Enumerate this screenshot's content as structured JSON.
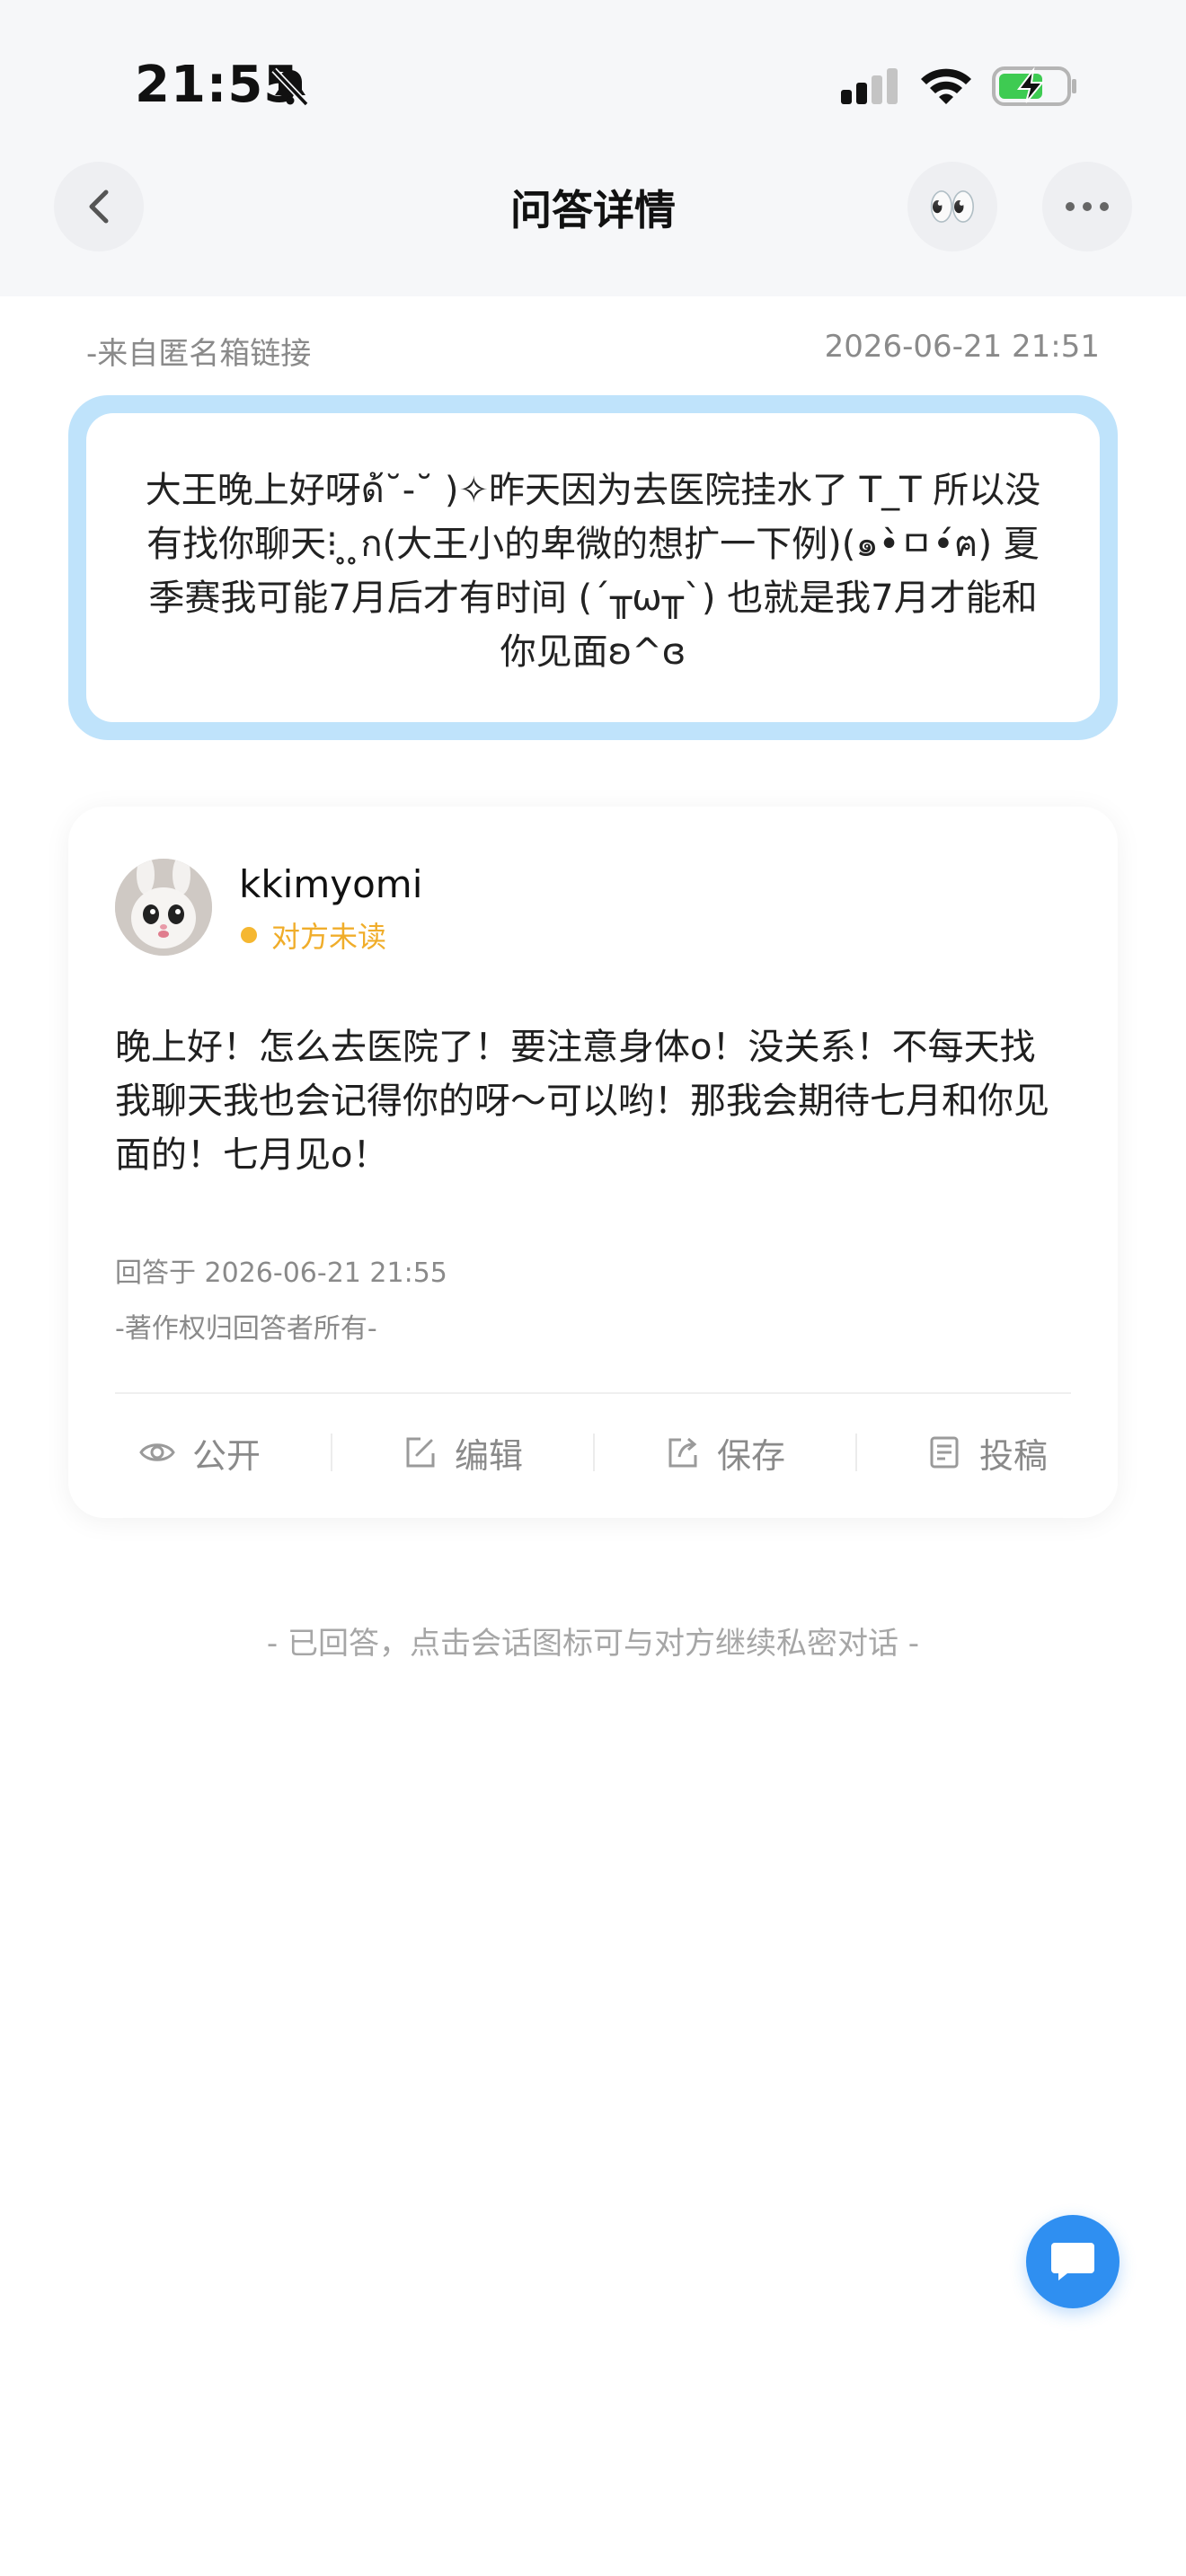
{
  "status_bar": {
    "time": "21:55",
    "icons": [
      "bell-mute-icon",
      "signal-icon",
      "wifi-icon",
      "battery-charging-icon"
    ]
  },
  "header": {
    "title": "问答详情",
    "back_icon": "chevron-left-icon",
    "eyes_emoji": "👀",
    "more_icon": "more-dots-icon"
  },
  "question": {
    "source": "-来自匿名箱链接",
    "date": "2026-06-21 21:51",
    "text": "大王晚上好呀ด้˘-˘ )✧昨天因为去医院挂水了 T_T 所以没有找你聊天⁝ ̥ ̥ก(大王小的卑微的想扩一下例)(๑•̀ㅁ•́ฅ) 夏季赛我可能7月后才有时间 (´╥ω╥`) 也就是我7月才能和你见面ʚ^ɞ"
  },
  "answer": {
    "username": "kkimyomi",
    "read_status": "对方未读",
    "text": "晚上好！怎么去医院了！要注意身体o！没关系！不每天找我聊天我也会记得你的呀～可以哟！那我会期待七月和你见面的！七月见o！",
    "answered_at": "回答于 2026-06-21 21:55",
    "copyright": "-著作权归回答者所有-",
    "actions": [
      {
        "label": "公开",
        "icon": "eye-icon"
      },
      {
        "label": "编辑",
        "icon": "edit-icon"
      },
      {
        "label": "保存",
        "icon": "share-icon"
      },
      {
        "label": "投稿",
        "icon": "submit-icon"
      }
    ]
  },
  "footer": {
    "tip": "- 已回答，点击会话图标可与对方继续私密对话 -"
  },
  "colors": {
    "accent": "#2f8ff1",
    "question_border": "#bfe3fb",
    "unread": "#f5b731"
  }
}
